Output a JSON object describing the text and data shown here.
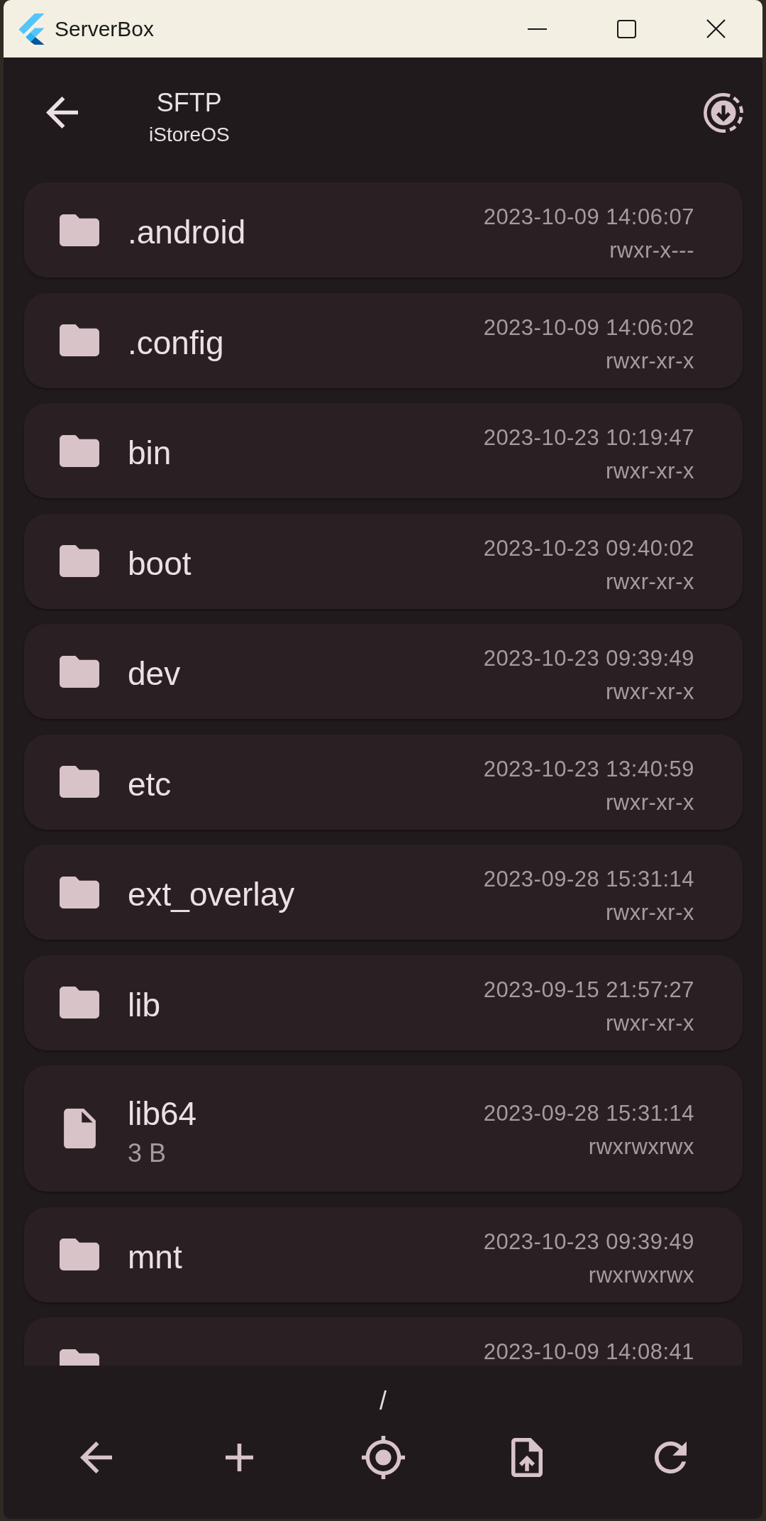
{
  "window": {
    "title": "ServerBox"
  },
  "app_bar": {
    "title": "SFTP",
    "subtitle": "iStoreOS"
  },
  "files": [
    {
      "kind": "folder",
      "name": ".android",
      "modified": "2023-10-09 14:06:07",
      "permissions": "rwxr-x---"
    },
    {
      "kind": "folder",
      "name": ".config",
      "modified": "2023-10-09 14:06:02",
      "permissions": "rwxr-xr-x"
    },
    {
      "kind": "folder",
      "name": "bin",
      "modified": "2023-10-23 10:19:47",
      "permissions": "rwxr-xr-x"
    },
    {
      "kind": "folder",
      "name": "boot",
      "modified": "2023-10-23 09:40:02",
      "permissions": "rwxr-xr-x"
    },
    {
      "kind": "folder",
      "name": "dev",
      "modified": "2023-10-23 09:39:49",
      "permissions": "rwxr-xr-x"
    },
    {
      "kind": "folder",
      "name": "etc",
      "modified": "2023-10-23 13:40:59",
      "permissions": "rwxr-xr-x"
    },
    {
      "kind": "folder",
      "name": "ext_overlay",
      "modified": "2023-09-28 15:31:14",
      "permissions": "rwxr-xr-x"
    },
    {
      "kind": "folder",
      "name": "lib",
      "modified": "2023-09-15 21:57:27",
      "permissions": "rwxr-xr-x"
    },
    {
      "kind": "file",
      "name": "lib64",
      "size": "3 B",
      "modified": "2023-09-28 15:31:14",
      "permissions": "rwxrwxrwx"
    },
    {
      "kind": "folder",
      "name": "mnt",
      "modified": "2023-10-23 09:39:49",
      "permissions": "rwxrwxrwx"
    },
    {
      "kind": "folder",
      "modified": "2023-10-09 14:08:41"
    }
  ],
  "path": "/"
}
